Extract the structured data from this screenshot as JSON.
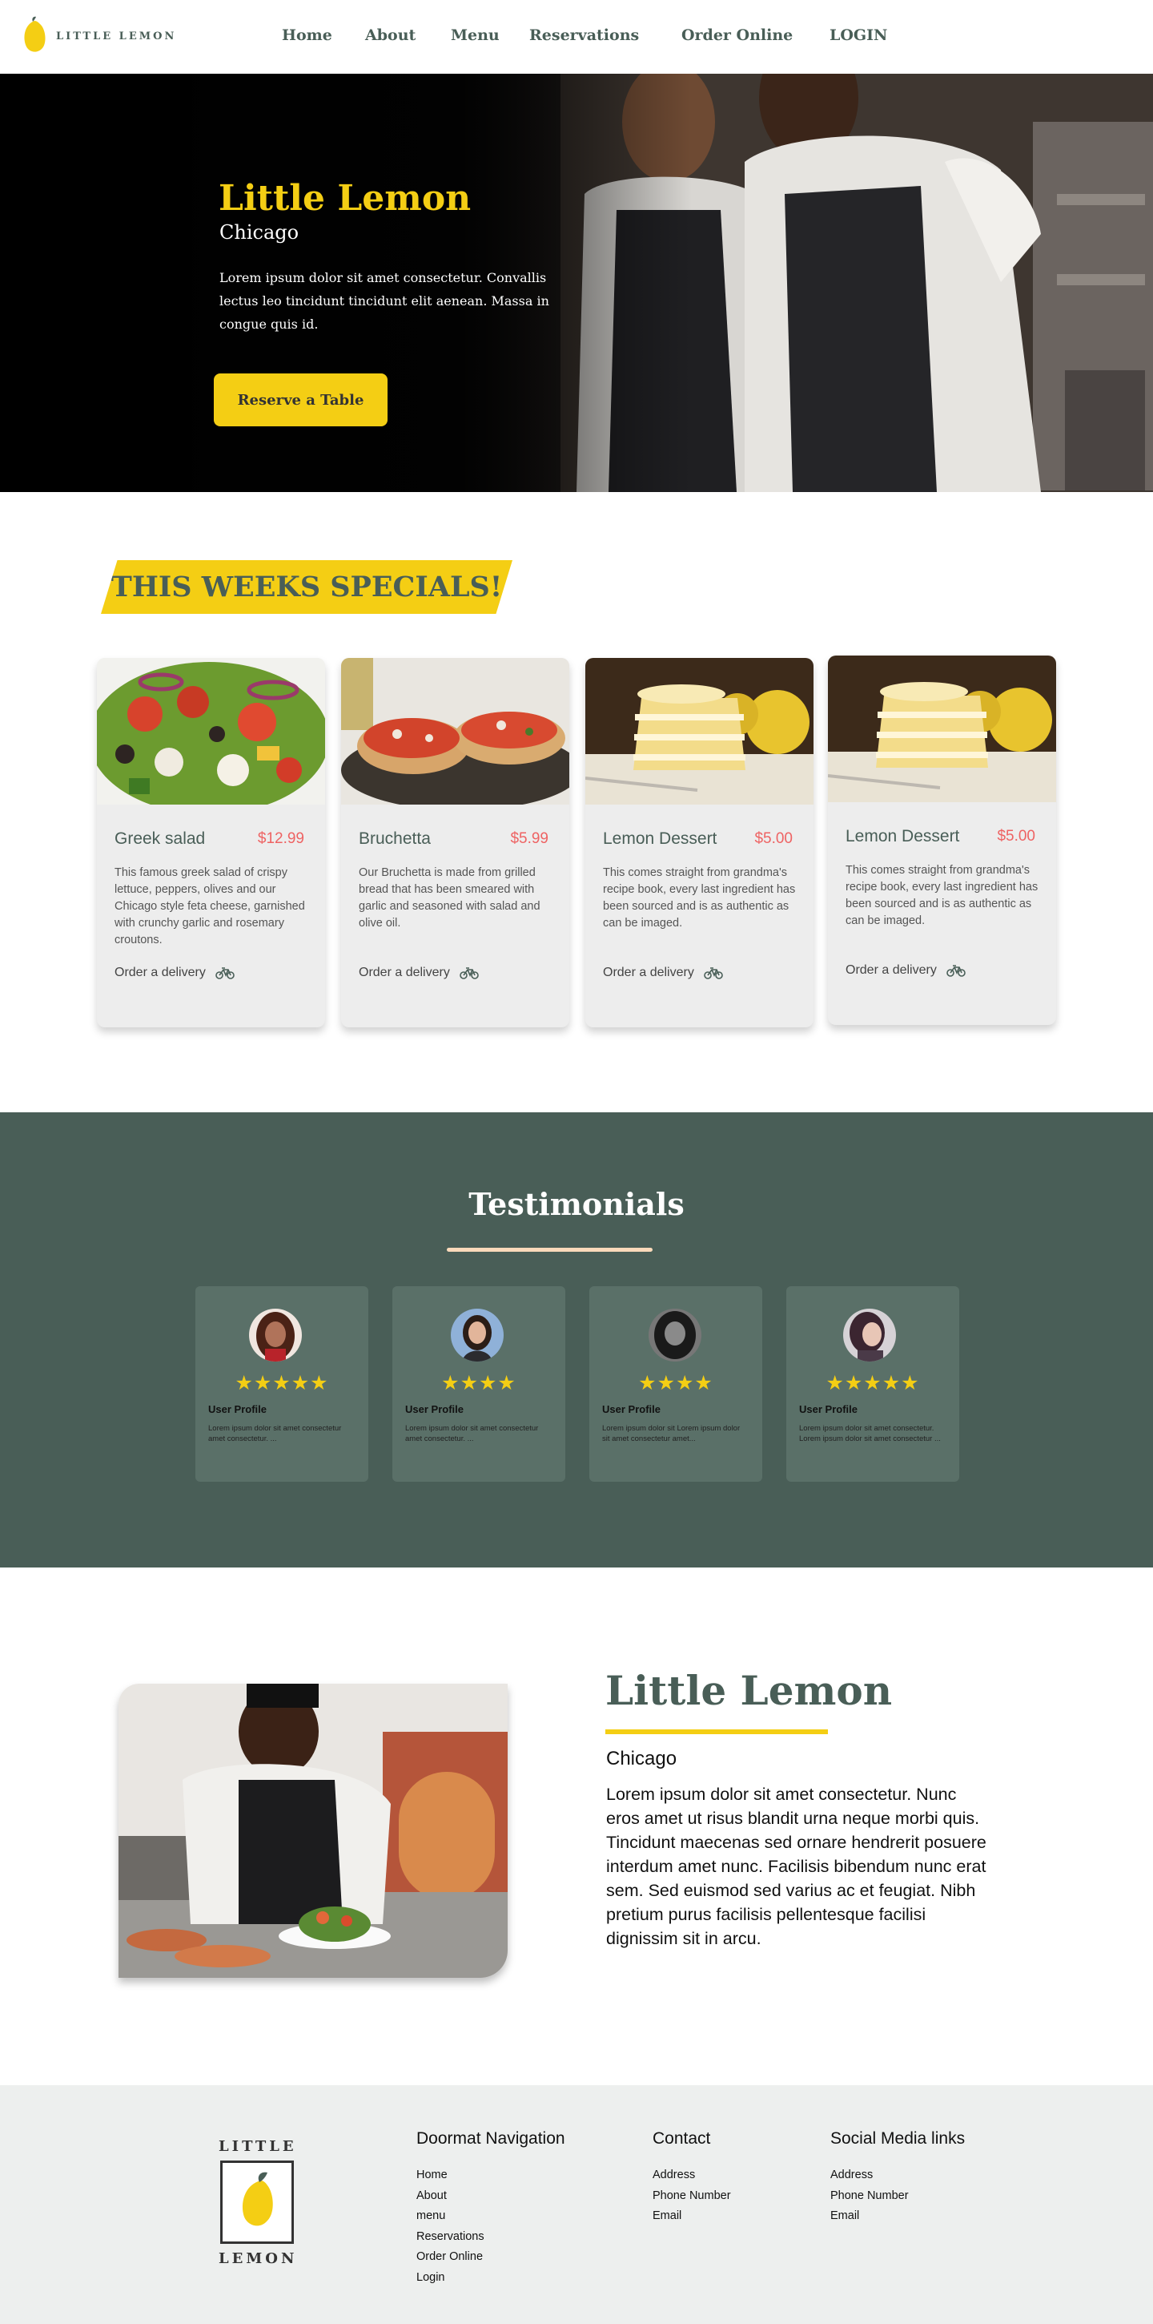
{
  "brand": {
    "name": "LITTLE LEMON",
    "primary": "#495e57",
    "accent": "#f4ce14",
    "price": "#ee6363"
  },
  "nav": {
    "links": [
      "Home",
      "About",
      "Menu",
      "Reservations",
      "Order Online",
      "LOGIN"
    ]
  },
  "hero": {
    "title": "Little Lemon",
    "subtitle": "Chicago",
    "description": "Lorem ipsum dolor sit amet consectetur. Convallis lectus leo tincidunt tincidunt elit aenean. Massa in congue quis id.",
    "cta": "Reserve a Table"
  },
  "specials": {
    "heading": "THIS WEEKS SPECIALS!",
    "items": [
      {
        "name": "Greek salad",
        "price": "$12.99",
        "description": "This famous greek salad of crispy lettuce, peppers, olives and our Chicago style feta cheese, garnished with crunchy garlic and rosemary croutons.",
        "order": "Order a delivery"
      },
      {
        "name": "Bruchetta",
        "price": "$5.99",
        "description": "Our Bruchetta is made from grilled bread that has been smeared with garlic and seasoned with salad and olive oil.",
        "order": "Order a delivery"
      },
      {
        "name": "Lemon Dessert",
        "price": "$5.00",
        "description": "This comes straight from grandma's recipe book, every last ingredient has been sourced and is as authentic as can be imaged.",
        "order": "Order a delivery"
      },
      {
        "name": "Lemon Dessert",
        "price": "$5.00",
        "description": "This comes straight from grandma's recipe book, every last ingredient has been sourced and is as authentic as can be imaged.",
        "order": "Order a delivery"
      }
    ]
  },
  "testimonials": {
    "heading": "Testimonials",
    "items": [
      {
        "stars": "★★★★★",
        "name": "User Profile",
        "text": "Lorem ipsum dolor sit amet consectetur amet consectetur. ..."
      },
      {
        "stars": "★★★★",
        "name": "User Profile",
        "text": "Lorem ipsum dolor sit amet consectetur amet consectetur. ..."
      },
      {
        "stars": "★★★★",
        "name": "User Profile",
        "text": "Lorem ipsum dolor sit Lorem ipsum dolor sit amet consectetur amet..."
      },
      {
        "stars": "★★★★★",
        "name": "User Profile",
        "text": "Lorem ipsum dolor sit amet consectetur. Lorem ipsum dolor sit amet consectetur ..."
      }
    ]
  },
  "about": {
    "title": "Little Lemon",
    "subtitle": "Chicago",
    "description": "Lorem ipsum dolor sit amet consectetur. Nunc eros amet ut risus blandit urna neque morbi quis. Tincidunt maecenas sed ornare hendrerit posuere interdum amet nunc. Facilisis bibendum nunc erat sem. Sed euismod sed varius ac et feugiat. Nibh pretium purus facilisis pellentesque facilisi dignissim sit in arcu."
  },
  "footer": {
    "logo_top": "LITTLE",
    "logo_bottom": "LEMON",
    "columns": [
      {
        "title": "Doormat Navigation",
        "links": [
          "Home",
          "About",
          "menu",
          "Reservations",
          "Order Online",
          "Login"
        ]
      },
      {
        "title": "Contact",
        "links": [
          "Address",
          "Phone Number",
          "Email"
        ]
      },
      {
        "title": "Social Media links",
        "links": [
          "Address",
          "Phone Number",
          "Email"
        ]
      }
    ]
  }
}
